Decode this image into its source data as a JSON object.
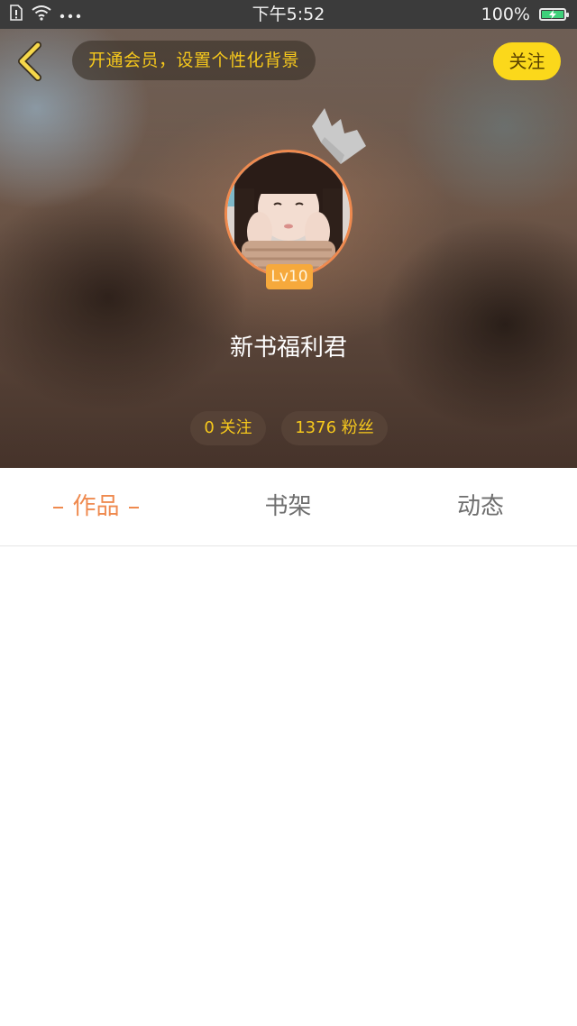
{
  "status_bar": {
    "time": "下午5:52",
    "battery_percent": "100%",
    "icons": [
      "sim-icon",
      "wifi-icon",
      "more-dots-icon",
      "battery-charging-icon"
    ]
  },
  "header": {
    "vip_prompt": "开通会员，设置个性化背景",
    "follow_label": "关注",
    "back_icon": "chevron-left-icon"
  },
  "profile": {
    "level": "Lv10",
    "name": "新书福利君",
    "following": "0 关注",
    "fans": "1376 粉丝"
  },
  "tabs": [
    {
      "label": "作品",
      "active": true
    },
    {
      "label": "书架",
      "active": false
    },
    {
      "label": "动态",
      "active": false
    }
  ],
  "colors": {
    "accent_orange": "#ef8a4f",
    "yellow_button": "#fbd81b",
    "yellow_text": "#f6c81c",
    "badge": "#f6a93c"
  }
}
